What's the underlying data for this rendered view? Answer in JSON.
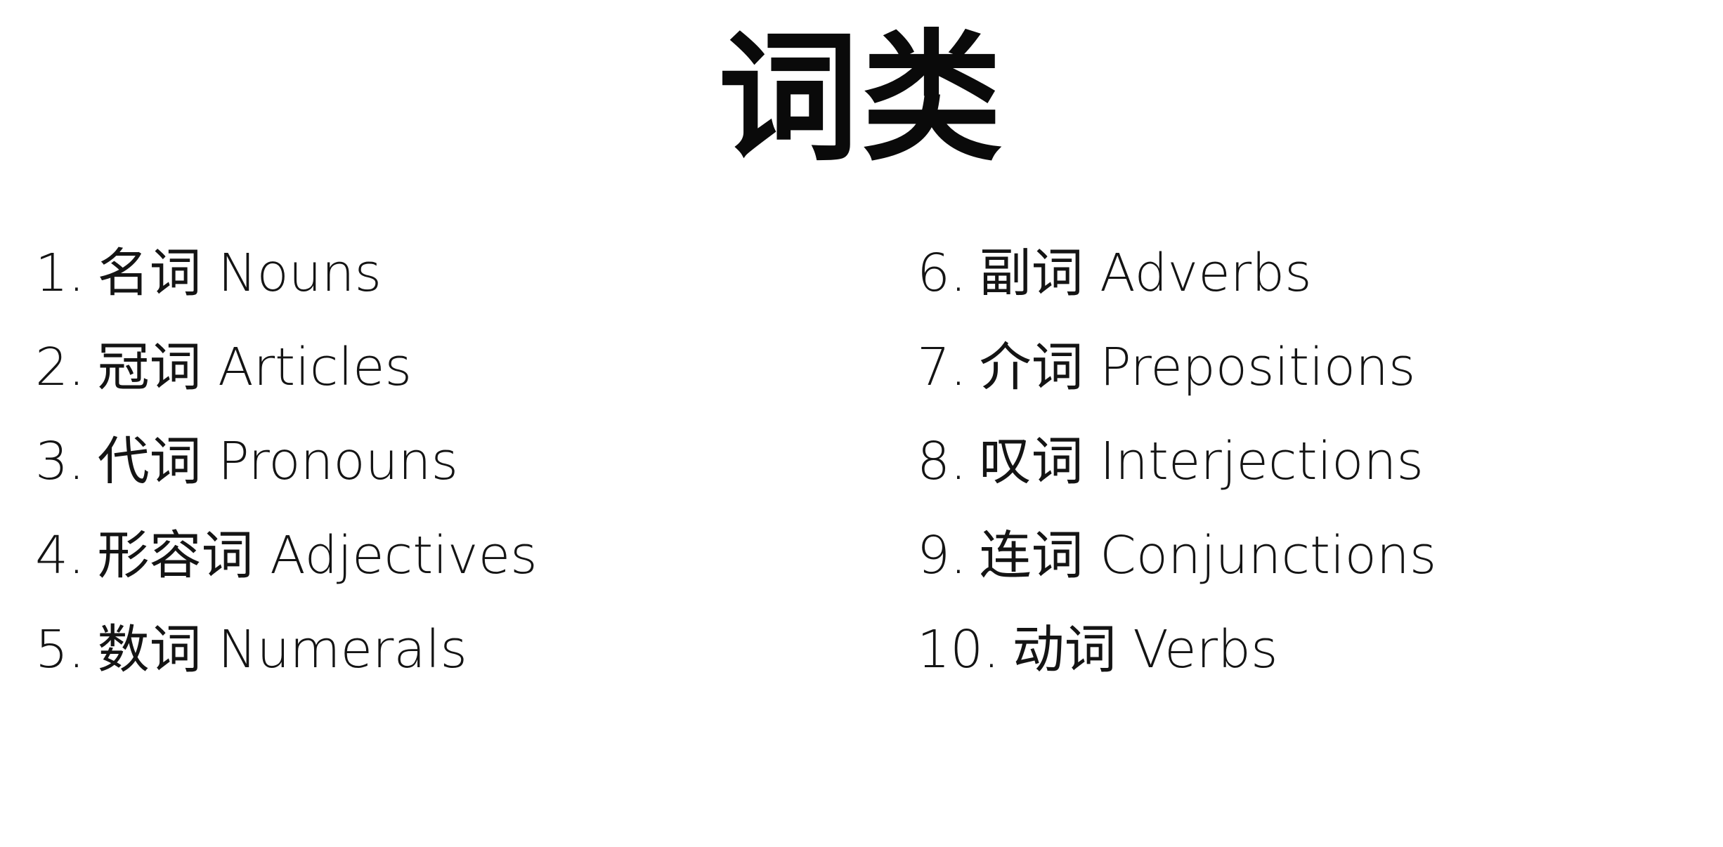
{
  "title": "词类",
  "items": [
    {
      "number": "1.",
      "label": "名词 Nouns"
    },
    {
      "number": "2.",
      "label": "冠词 Articles"
    },
    {
      "number": "3.",
      "label": "代词 Pronouns"
    },
    {
      "number": "4.",
      "label": "形容词 Adjectives"
    },
    {
      "number": "5.",
      "label": "数词 Numerals"
    },
    {
      "number": "6.",
      "label": "副词 Adverbs"
    },
    {
      "number": "7.",
      "label": "介词 Prepositions"
    },
    {
      "number": "8.",
      "label": "叹词 Interjections"
    },
    {
      "number": "9.",
      "label": "连词 Conjunctions"
    },
    {
      "number": "10.",
      "label": "动词 Verbs"
    }
  ]
}
